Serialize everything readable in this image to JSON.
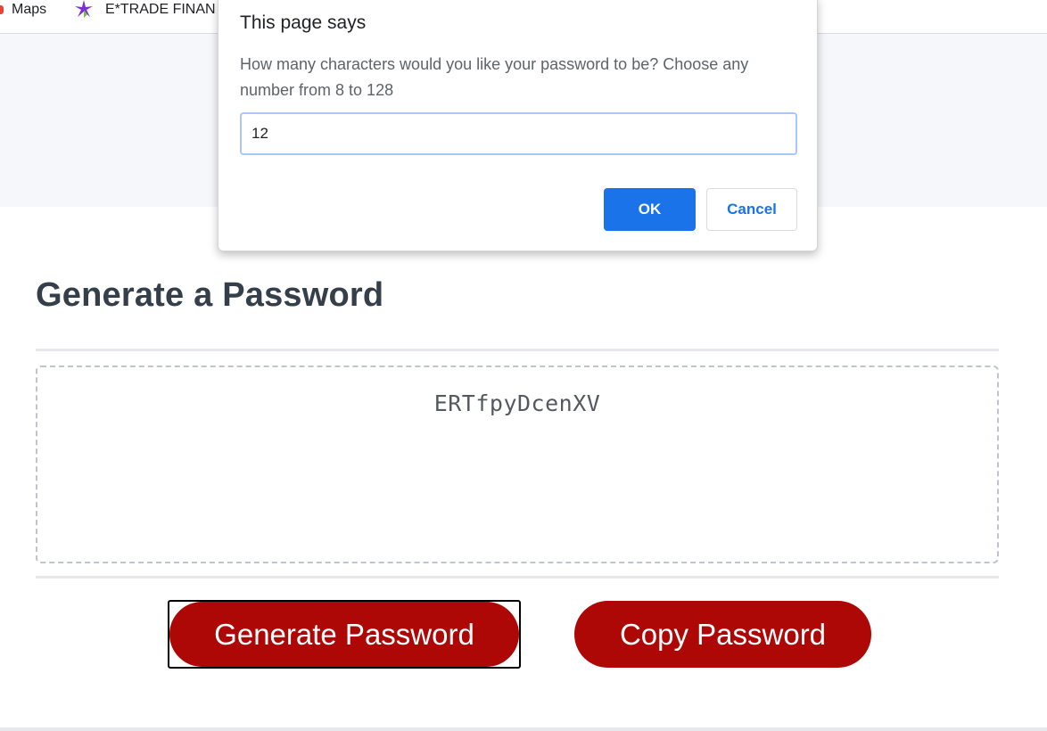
{
  "bookmarks": [
    {
      "label": "Maps",
      "icon": "maps-icon"
    },
    {
      "label": "E*TRADE FINAN",
      "icon": "etrade-icon"
    }
  ],
  "card": {
    "title": "Generate a Password",
    "password": "ERTfpyDcenXV",
    "generate_label": "Generate Password",
    "copy_label": "Copy Password"
  },
  "dialog": {
    "title": "This page says",
    "message": "How many characters would you like your password to be? Choose any number from 8 to 128",
    "input_value": "12",
    "ok_label": "OK",
    "cancel_label": "Cancel"
  },
  "colors": {
    "button_red": "#ae0806",
    "heading": "#353f4a",
    "dialog_blue": "#1a73e8",
    "hero_band": "#f5f7fa"
  }
}
